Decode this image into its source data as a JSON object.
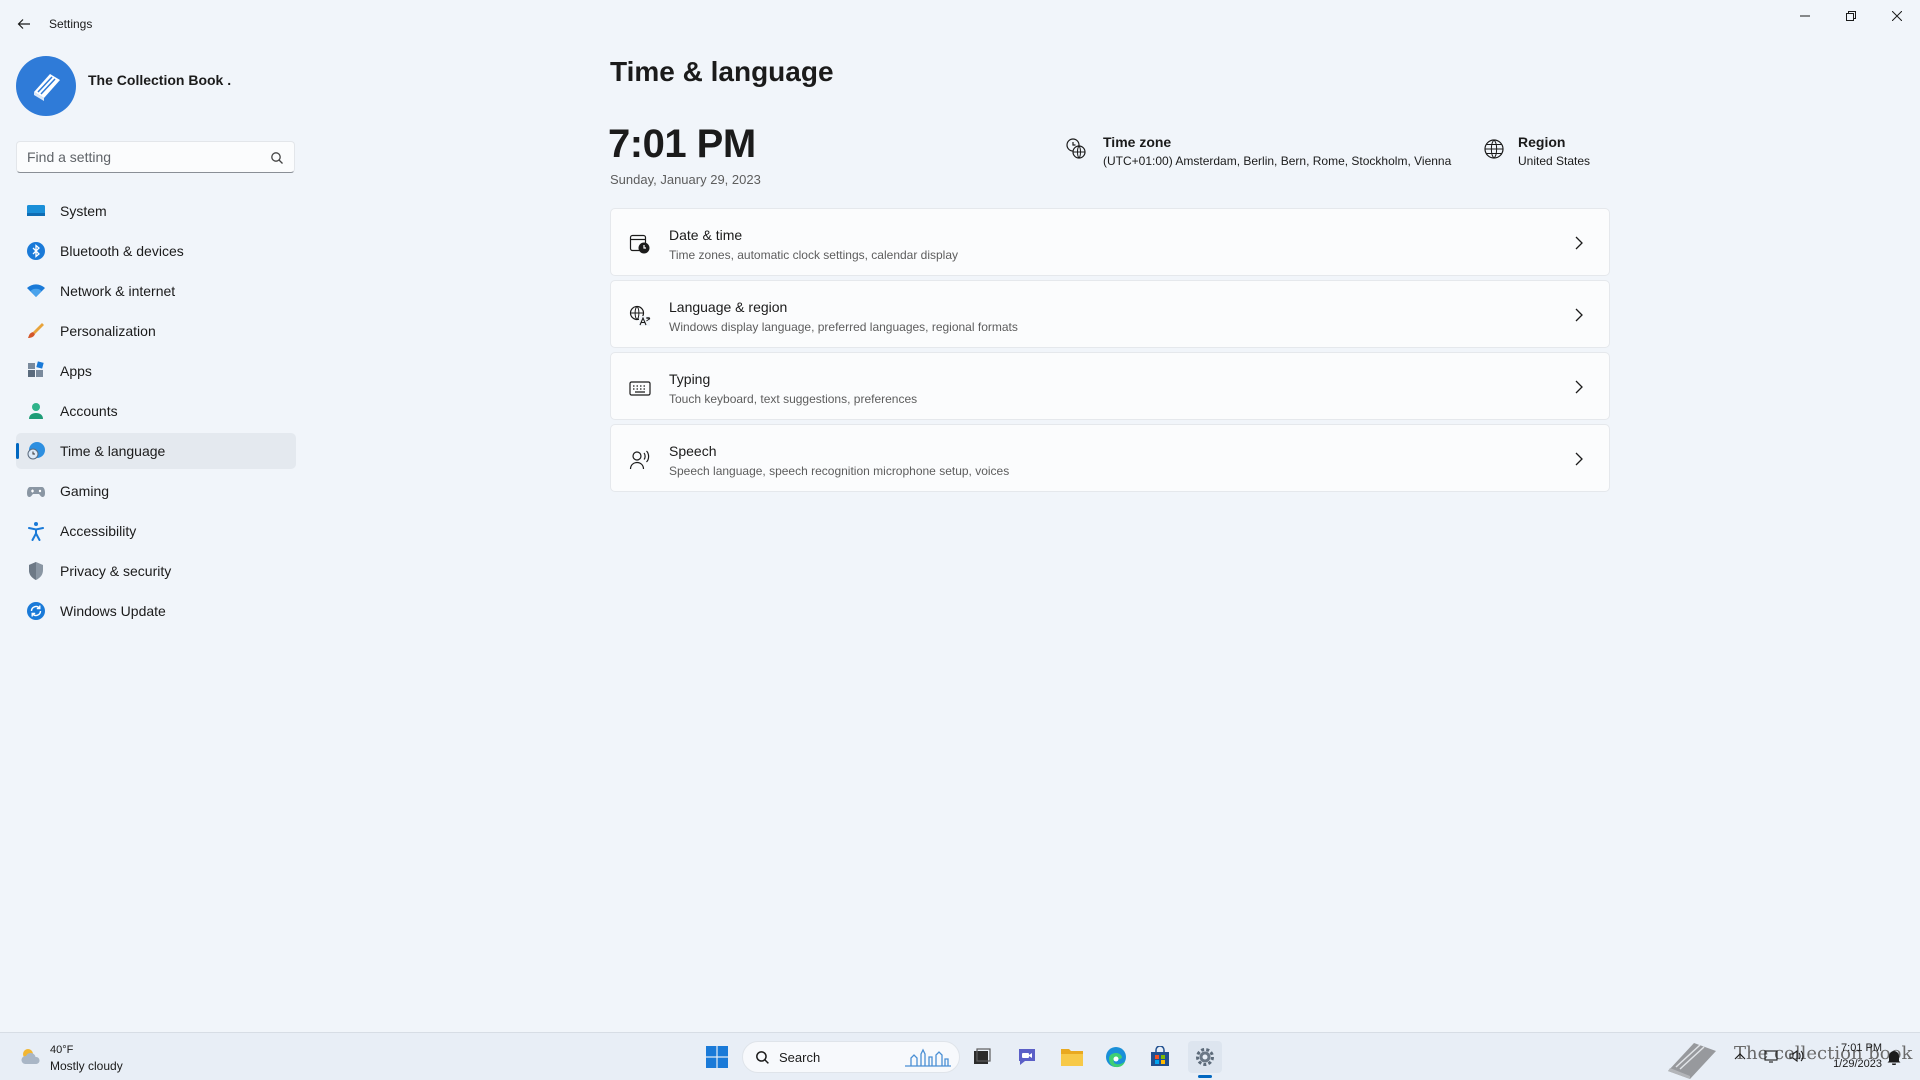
{
  "window": {
    "title": "Settings"
  },
  "profile": {
    "name": "The Collection Book ."
  },
  "search": {
    "placeholder": "Find a setting"
  },
  "nav": {
    "items": [
      {
        "label": "System",
        "icon": "monitor-icon",
        "active": false
      },
      {
        "label": "Bluetooth & devices",
        "icon": "bluetooth-icon",
        "active": false
      },
      {
        "label": "Network & internet",
        "icon": "wifi-icon",
        "active": false
      },
      {
        "label": "Personalization",
        "icon": "brush-icon",
        "active": false
      },
      {
        "label": "Apps",
        "icon": "apps-icon",
        "active": false
      },
      {
        "label": "Accounts",
        "icon": "person-icon",
        "active": false
      },
      {
        "label": "Time & language",
        "icon": "clock-globe-icon",
        "active": true
      },
      {
        "label": "Gaming",
        "icon": "gamepad-icon",
        "active": false
      },
      {
        "label": "Accessibility",
        "icon": "accessibility-icon",
        "active": false
      },
      {
        "label": "Privacy & security",
        "icon": "shield-icon",
        "active": false
      },
      {
        "label": "Windows Update",
        "icon": "update-icon",
        "active": false
      }
    ]
  },
  "main": {
    "title": "Time & language",
    "time": "7:01 PM",
    "date": "Sunday, January 29, 2023",
    "time_zone": {
      "label": "Time zone",
      "value": "(UTC+01:00) Amsterdam, Berlin, Bern, Rome, Stockholm, Vienna"
    },
    "region": {
      "label": "Region",
      "value": "United States"
    },
    "cards": [
      {
        "title": "Date & time",
        "subtitle": "Time zones, automatic clock settings, calendar display",
        "icon": "calendar-clock-icon"
      },
      {
        "title": "Language & region",
        "subtitle": "Windows display language, preferred languages, regional formats",
        "icon": "language-icon"
      },
      {
        "title": "Typing",
        "subtitle": "Touch keyboard, text suggestions, preferences",
        "icon": "keyboard-icon"
      },
      {
        "title": "Speech",
        "subtitle": "Speech language, speech recognition microphone setup, voices",
        "icon": "speech-icon"
      }
    ]
  },
  "taskbar": {
    "weather": {
      "temp": "40°F",
      "desc": "Mostly cloudy"
    },
    "search_label": "Search",
    "clock_time": "7:01 PM",
    "clock_date": "1/29/2023",
    "watermark": "The collection book"
  },
  "colors": {
    "accent": "#0067c0",
    "avatar": "#2f7bd8",
    "background": "#f1f5fa"
  }
}
